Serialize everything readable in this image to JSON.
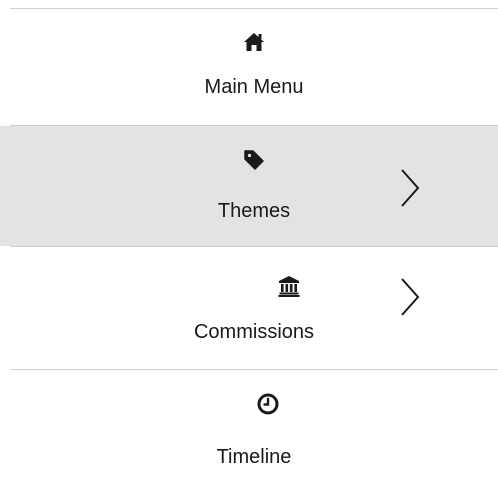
{
  "menu": {
    "items": [
      {
        "label": "Main Menu",
        "icon": "home-icon",
        "active": false,
        "has_submenu": false
      },
      {
        "label": "Themes",
        "icon": "tag-icon",
        "active": true,
        "has_submenu": true
      },
      {
        "label": "Commissions",
        "icon": "institution-icon",
        "active": false,
        "has_submenu": true
      },
      {
        "label": "Timeline",
        "icon": "clock-icon",
        "active": false,
        "has_submenu": false
      }
    ]
  },
  "colors": {
    "active_background": "#e3e3e3",
    "divider": "#cfcfcf",
    "text": "#1a1a1a"
  }
}
